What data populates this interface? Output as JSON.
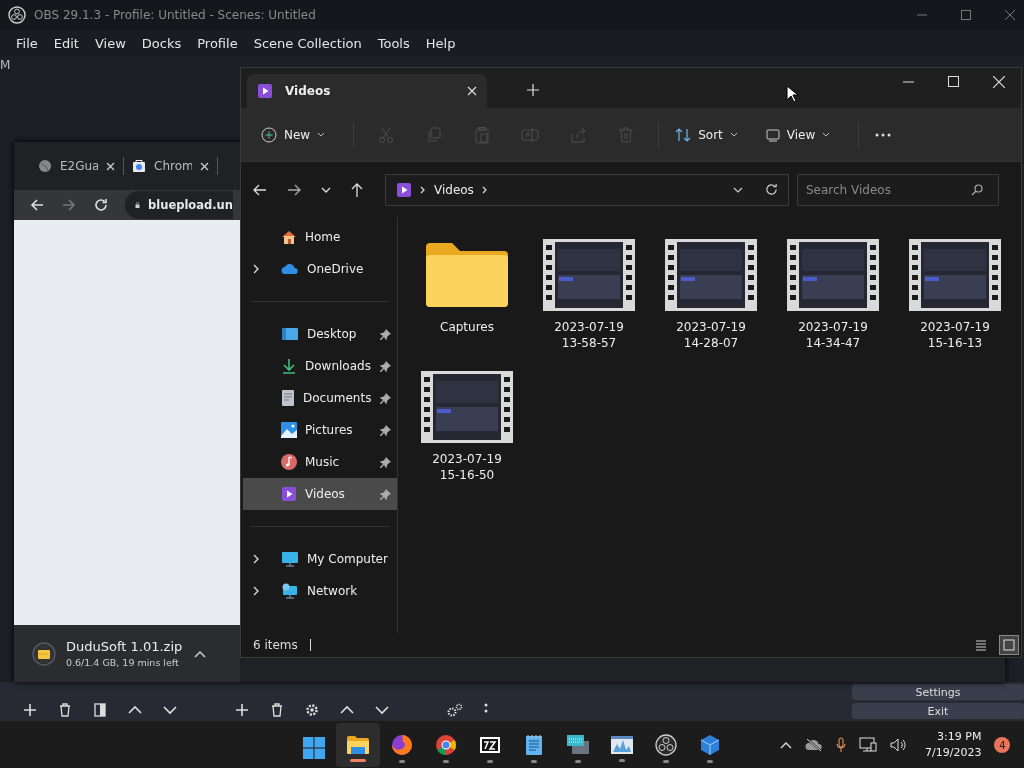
{
  "obs": {
    "title": "OBS 29.1.3 - Profile: Untitled - Scenes: Untitled",
    "menu": [
      "File",
      "Edit",
      "View",
      "Docks",
      "Profile",
      "Scene Collection",
      "Tools",
      "Help"
    ],
    "stray_label": "M",
    "side_buttons": [
      "Settings",
      "Exit"
    ]
  },
  "browser": {
    "tabs": [
      {
        "label": "E2Gua",
        "selected": false
      },
      {
        "label": "Chrom",
        "selected": false
      }
    ],
    "address": "bluepload.un",
    "download": {
      "file": "DuduSoft 1.01.zip",
      "status": "0.6/1.4 GB, 19 mins left"
    }
  },
  "explorer": {
    "tab": "Videos",
    "toolbar": {
      "new": "New",
      "actions": [
        {
          "disabled": true
        },
        {
          "disabled": true
        },
        {
          "disabled": true
        },
        {
          "disabled": true
        },
        {
          "disabled": true
        },
        {
          "disabled": true
        }
      ],
      "sort": "Sort",
      "view": "View"
    },
    "address": "Videos",
    "search": {
      "placeholder": "Search Videos"
    },
    "sidebar": [
      [
        {
          "label": "Home",
          "expandable": false,
          "pinned": false,
          "selected": false
        },
        {
          "label": "OneDrive",
          "expandable": true,
          "pinned": false,
          "selected": false
        }
      ],
      [
        {
          "label": "Desktop",
          "expandable": false,
          "pinned": true,
          "selected": false
        },
        {
          "label": "Downloads",
          "expandable": false,
          "pinned": true,
          "selected": false
        },
        {
          "label": "Documents",
          "expandable": false,
          "pinned": true,
          "selected": false
        },
        {
          "label": "Pictures",
          "expandable": false,
          "pinned": true,
          "selected": false
        },
        {
          "label": "Music",
          "expandable": false,
          "pinned": true,
          "selected": false
        },
        {
          "label": "Videos",
          "expandable": false,
          "pinned": true,
          "selected": true
        }
      ],
      [
        {
          "label": "My Computer",
          "expandable": true,
          "pinned": false,
          "selected": false
        },
        {
          "label": "Network",
          "expandable": true,
          "pinned": false,
          "selected": false
        }
      ]
    ],
    "files": [
      {
        "name": "Captures",
        "kind": "folder"
      },
      {
        "name": "2023-07-19 13-58-57",
        "kind": "video"
      },
      {
        "name": "2023-07-19 14-28-07",
        "kind": "video"
      },
      {
        "name": "2023-07-19 14-34-47",
        "kind": "video"
      },
      {
        "name": "2023-07-19 15-16-13",
        "kind": "video"
      },
      {
        "name": "2023-07-19 15-16-50",
        "kind": "video"
      }
    ],
    "status": "6 items",
    "layouts": [
      {
        "selected": false
      },
      {
        "selected": true
      }
    ]
  },
  "taskbar": {
    "apps": [
      {
        "selected": false,
        "running": false
      },
      {
        "selected": true,
        "running": true
      },
      {
        "selected": false,
        "running": true
      },
      {
        "selected": false,
        "running": true
      },
      {
        "selected": false,
        "running": true
      },
      {
        "selected": false,
        "running": true
      },
      {
        "selected": false,
        "running": true
      },
      {
        "selected": false,
        "running": true
      },
      {
        "selected": false,
        "running": true
      },
      {
        "selected": false,
        "running": true
      }
    ],
    "time": "3:19 PM",
    "date": "7/19/2023",
    "badge": "4"
  }
}
